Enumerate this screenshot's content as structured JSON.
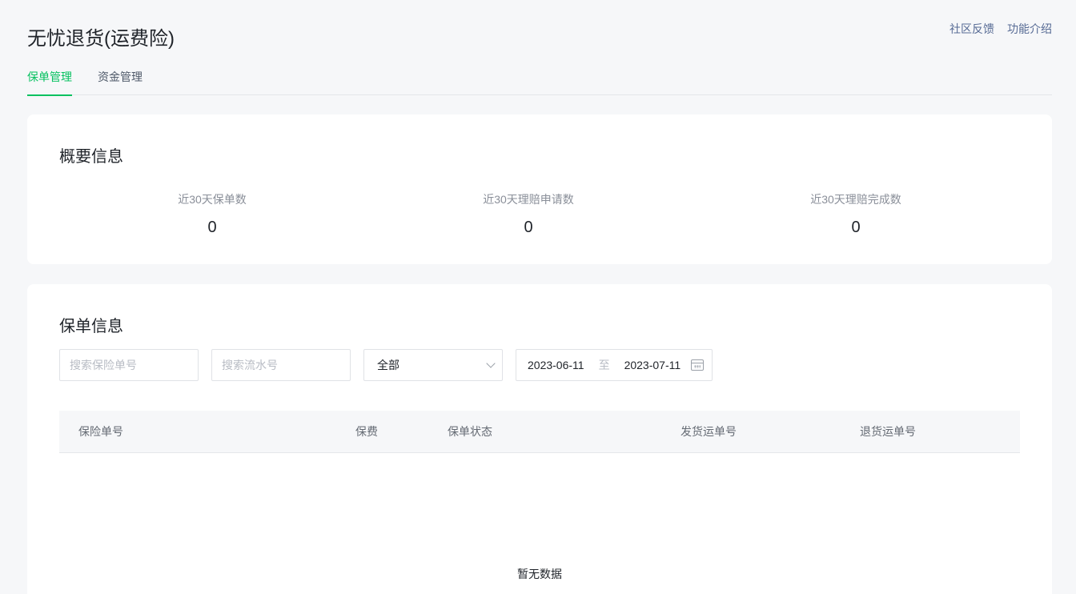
{
  "header": {
    "title": "无忧退货(运费险)",
    "links": [
      "社区反馈",
      "功能介绍"
    ]
  },
  "tabs": [
    {
      "label": "保单管理",
      "active": true
    },
    {
      "label": "资金管理",
      "active": false
    }
  ],
  "summary": {
    "title": "概要信息",
    "stats": [
      {
        "label": "近30天保单数",
        "value": "0"
      },
      {
        "label": "近30天理赔申请数",
        "value": "0"
      },
      {
        "label": "近30天理赔完成数",
        "value": "0"
      }
    ]
  },
  "policy": {
    "title": "保单信息",
    "filters": {
      "policy_no_placeholder": "搜索保险单号",
      "serial_no_placeholder": "搜索流水号",
      "status_selected": "全部",
      "date_start": "2023-06-11",
      "date_sep": "至",
      "date_end": "2023-07-11"
    },
    "columns": [
      "保险单号",
      "保费",
      "保单状态",
      "发货运单号",
      "退货运单号"
    ],
    "rows": [],
    "empty_text": "暂无数据"
  },
  "colors": {
    "accent": "#07c160",
    "link": "#576b95",
    "background": "#f6f7f9"
  }
}
